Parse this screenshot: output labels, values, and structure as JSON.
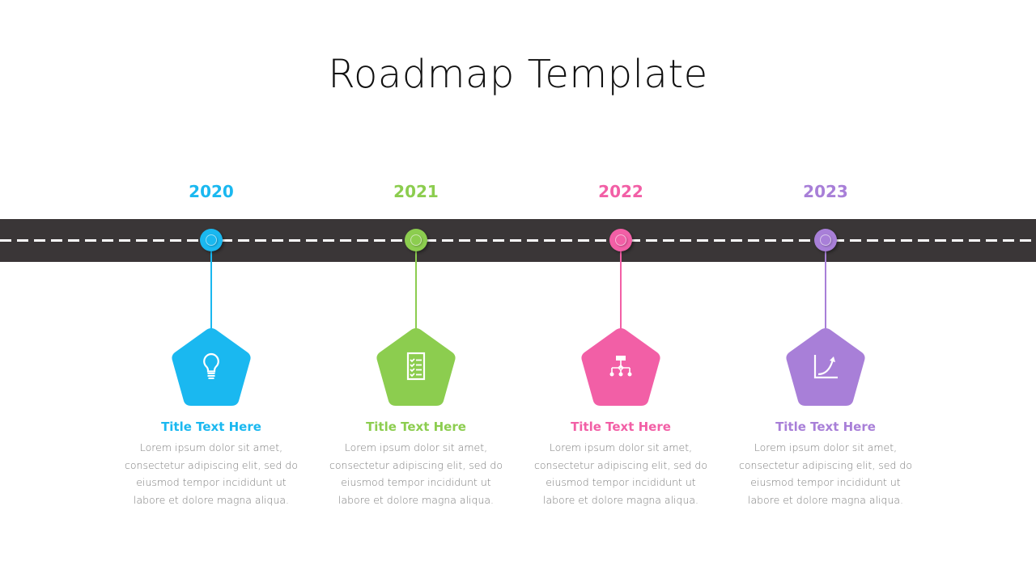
{
  "title": "Roadmap Template",
  "milestones": [
    {
      "year": "2020",
      "color": "#1ab8f0",
      "icon": "lightbulb-icon",
      "title": "Title Text Here",
      "body": [
        "Lorem ipsum dolor sit amet,",
        "consectetur adipiscing elit, sed do",
        "eiusmod tempor incididunt ut",
        "labore et dolore magna aliqua."
      ]
    },
    {
      "year": "2021",
      "color": "#8ccd4f",
      "icon": "checklist-icon",
      "title": "Title Text Here",
      "body": [
        "Lorem ipsum dolor sit amet,",
        "consectetur adipiscing elit, sed do",
        "eiusmod tempor incididunt ut",
        "labore et dolore magna aliqua."
      ]
    },
    {
      "year": "2022",
      "color": "#f25fa6",
      "icon": "hierarchy-icon",
      "title": "Title Text Here",
      "body": [
        "Lorem ipsum dolor sit amet,",
        "consectetur adipiscing elit, sed do",
        "eiusmod tempor incididunt ut",
        "labore et dolore magna aliqua."
      ]
    },
    {
      "year": "2023",
      "color": "#a87fd8",
      "icon": "growth-chart-icon",
      "title": "Title Text Here",
      "body": [
        "Lorem ipsum dolor sit amet,",
        "consectetur adipiscing elit, sed do",
        "eiusmod tempor incididunt ut",
        "labore et dolore magna aliqua."
      ]
    }
  ],
  "colors": {
    "road": "#3a3637",
    "road_dash": "#ffffff",
    "body_text": "#7a7a7a"
  }
}
